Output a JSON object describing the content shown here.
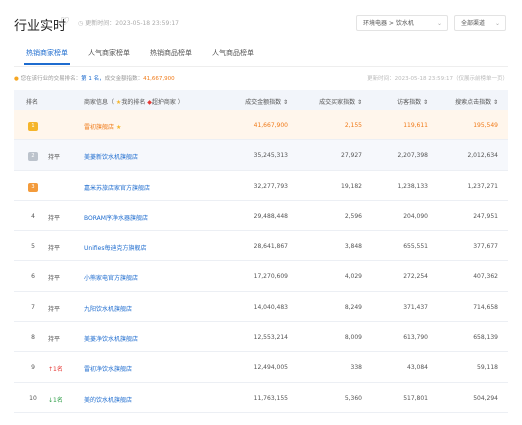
{
  "header": {
    "title": "行业实时",
    "update_label": "更新时间：2023-05-18 23:59:17",
    "category_select": "环境电器 > 饮水机",
    "channel_select": "全部渠道"
  },
  "tabs": [
    {
      "label": "热销商家榜单"
    },
    {
      "label": "人气商家榜单"
    },
    {
      "label": "热销商品榜单"
    },
    {
      "label": "人气商品榜单"
    }
  ],
  "info": {
    "prefix": "您在该行业的交易排名：",
    "rank": "第 1 名，",
    "gmv_label": "成交金额指数：",
    "gmv_value": "41,667,900",
    "right": "更新时间：2023-05-18 23:59:17（仅展示前榜单一页）"
  },
  "table": {
    "headers": [
      "排名",
      "商家信息（ ",
      "我的排名 ",
      "超护商家 ）",
      "成交金额指数 ⇕",
      "成交买家指数 ⇕",
      "访客指数 ⇕",
      "搜索点击指数 ⇕"
    ],
    "rows": [
      {
        "rank": "1",
        "medal": "1",
        "trend": "",
        "name": "雷初旗舰店",
        "gmv": "41,667,900",
        "buyers": "2,155",
        "visitors": "119,611",
        "search": "195,549"
      },
      {
        "rank": "2",
        "medal": "2",
        "trend": "持平",
        "name": "美菱新饮水机旗舰店",
        "gmv": "35,245,313",
        "buyers": "27,927",
        "visitors": "2,207,398",
        "search": "2,012,634"
      },
      {
        "rank": "3",
        "medal": "3",
        "trend": "",
        "name": "嘉米苏旅店家官方旗舰店",
        "gmv": "32,277,793",
        "buyers": "19,182",
        "visitors": "1,238,133",
        "search": "1,237,271"
      },
      {
        "rank": "4",
        "medal": "",
        "trend": "持平",
        "name": "BORAM序净水器旗舰店",
        "gmv": "29,488,448",
        "buyers": "2,596",
        "visitors": "204,090",
        "search": "247,951"
      },
      {
        "rank": "5",
        "medal": "",
        "trend": "持平",
        "name": "Unifies每迪克方旗舰店",
        "gmv": "28,641,867",
        "buyers": "3,848",
        "visitors": "655,551",
        "search": "377,677"
      },
      {
        "rank": "6",
        "medal": "",
        "trend": "持平",
        "name": "小熊家电官方旗舰店",
        "gmv": "17,270,609",
        "buyers": "4,029",
        "visitors": "272,254",
        "search": "407,362"
      },
      {
        "rank": "7",
        "medal": "",
        "trend": "持平",
        "name": "九阳饮水机旗舰店",
        "gmv": "14,040,483",
        "buyers": "8,249",
        "visitors": "371,437",
        "search": "714,658"
      },
      {
        "rank": "8",
        "medal": "",
        "trend": "持平",
        "name": "美菱净饮水机旗舰店",
        "gmv": "12,553,214",
        "buyers": "8,009",
        "visitors": "613,790",
        "search": "658,139"
      },
      {
        "rank": "9",
        "medal": "",
        "trend": "↑1名",
        "trend_dir": "up",
        "name": "雷初净饮水旗舰店",
        "gmv": "12,494,005",
        "buyers": "338",
        "visitors": "43,084",
        "search": "59,118"
      },
      {
        "rank": "10",
        "medal": "",
        "trend": "↓1名",
        "trend_dir": "down",
        "name": "美的饮水机旗舰店",
        "gmv": "11,763,155",
        "buyers": "5,360",
        "visitors": "517,801",
        "search": "504,294"
      }
    ]
  },
  "colors": {
    "accent": "#1e6ccf",
    "highlight": "#f07a18",
    "header_bg": "#f2f5fa"
  }
}
